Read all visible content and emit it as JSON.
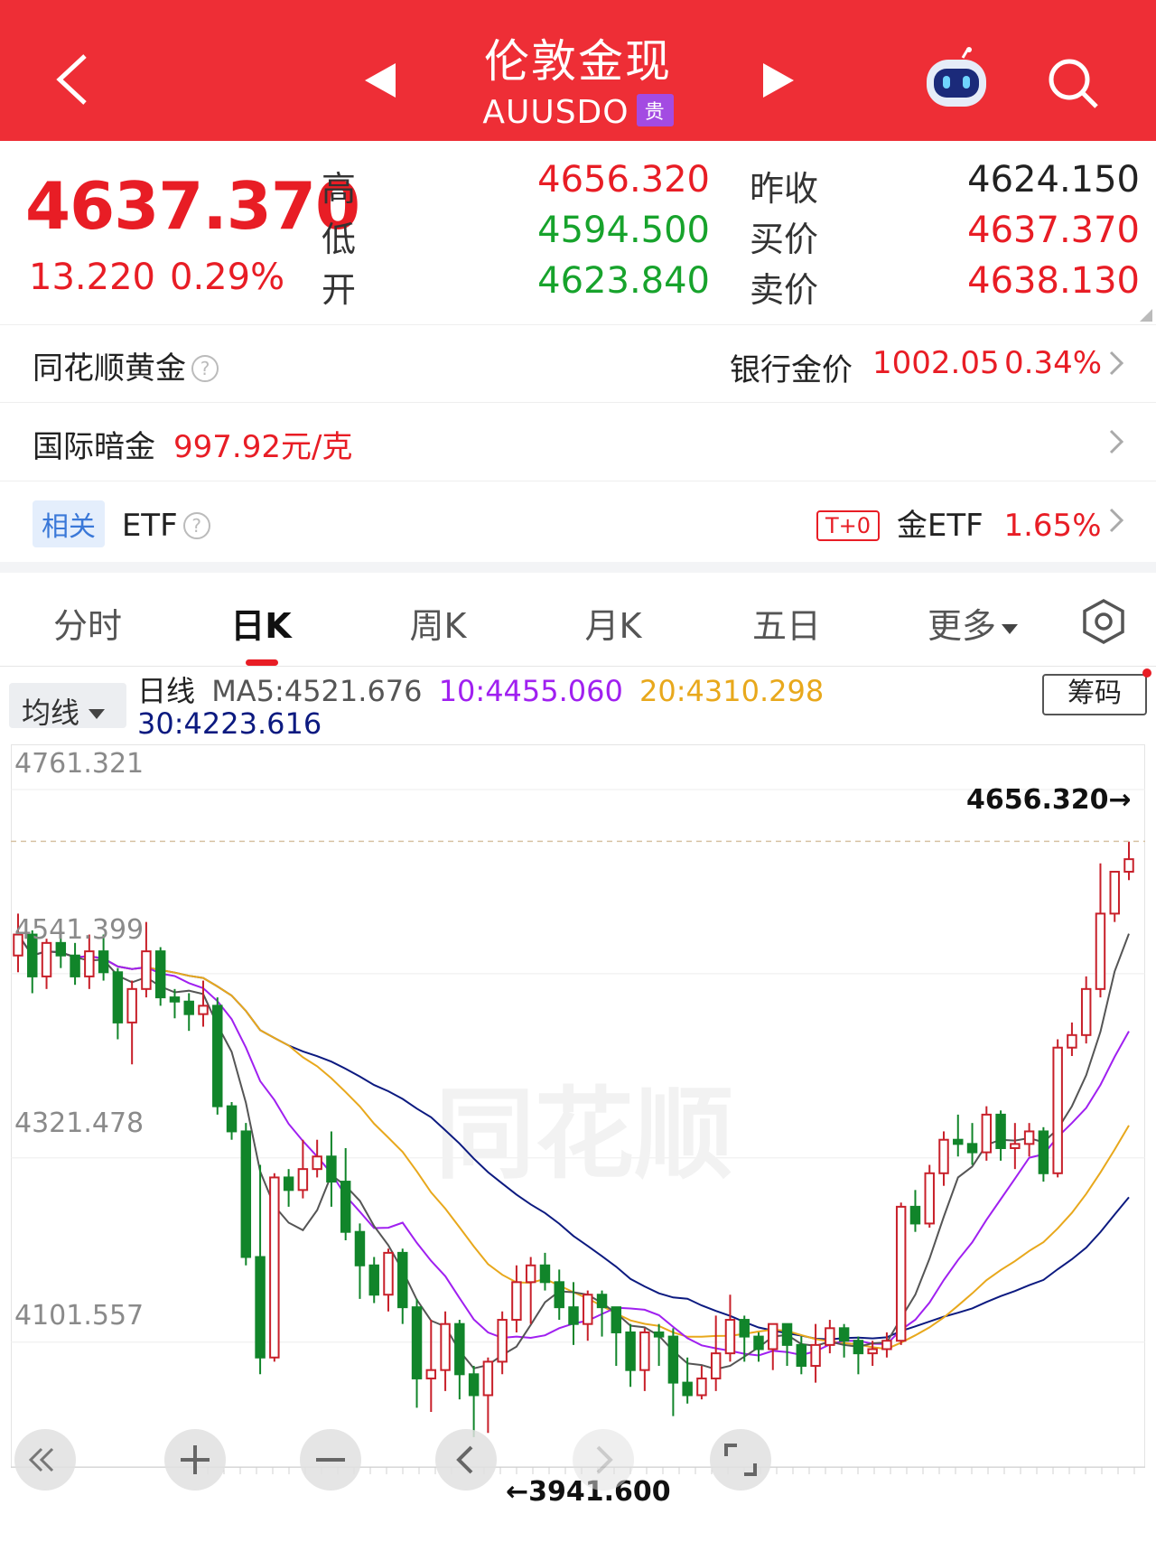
{
  "header": {
    "title": "伦敦金现",
    "code": "AUUSDO",
    "badge": "贵",
    "icons": [
      "back-icon",
      "prev-triangle-icon",
      "next-triangle-icon",
      "robot-icon",
      "search-icon"
    ]
  },
  "quote": {
    "price": "4637.370",
    "change": "13.220",
    "change_pct": "0.29%",
    "high_label": "高",
    "high": "4656.320",
    "low_label": "低",
    "low": "4594.500",
    "open_label": "开",
    "open": "4623.840",
    "prev_close_label": "昨收",
    "prev_close": "4624.150",
    "bid_label": "买价",
    "bid": "4637.370",
    "ask_label": "卖价",
    "ask": "4638.130"
  },
  "rows": {
    "ths_gold": {
      "label": "同花顺黄金",
      "bank_label": "银行金价",
      "bank_price": "1002.05",
      "bank_pct": "0.34%"
    },
    "intl_dark": {
      "label": "国际暗金",
      "value": "997.92元/克"
    },
    "etf": {
      "tag": "相关",
      "label": "ETF",
      "t0": "T+0",
      "etf_name": "金ETF",
      "etf_pct": "1.65%"
    }
  },
  "tabs": [
    "分时",
    "日K",
    "周K",
    "月K",
    "五日",
    "更多"
  ],
  "active_tab": "日K",
  "ma": {
    "select": "均线",
    "period": "日线",
    "ma5": "MA5:4521.676",
    "ma10": "10:4455.060",
    "ma20": "20:4310.298",
    "ma30": "30:4223.616",
    "chip_button": "筹码",
    "colors": {
      "ma5": "#555555",
      "ma10": "#a020f0",
      "ma20": "#e8a81c",
      "ma30": "#0c1a80"
    }
  },
  "chart_data": {
    "type": "candlestick",
    "y_tick_labels": [
      "4761.321",
      "4541.399",
      "4321.478",
      "4101.557"
    ],
    "high_label": "4656.320→",
    "low_label": "←3941.600",
    "ylim": [
      3941.6,
      4761.321
    ],
    "candles": [
      [
        4520,
        4545,
        4500,
        4570
      ],
      [
        4545,
        4495,
        4475,
        4550
      ],
      [
        4495,
        4535,
        4480,
        4540
      ],
      [
        4535,
        4520,
        4505,
        4550
      ],
      [
        4520,
        4495,
        4485,
        4535
      ],
      [
        4495,
        4525,
        4480,
        4545
      ],
      [
        4525,
        4500,
        4490,
        4545
      ],
      [
        4500,
        4440,
        4420,
        4505
      ],
      [
        4440,
        4480,
        4390,
        4490
      ],
      [
        4480,
        4525,
        4470,
        4560
      ],
      [
        4525,
        4470,
        4460,
        4530
      ],
      [
        4470,
        4465,
        4445,
        4480
      ],
      [
        4465,
        4450,
        4430,
        4475
      ],
      [
        4450,
        4460,
        4435,
        4490
      ],
      [
        4460,
        4340,
        4330,
        4470
      ],
      [
        4340,
        4310,
        4300,
        4345
      ],
      [
        4310,
        4160,
        4150,
        4320
      ],
      [
        4160,
        4040,
        4020,
        4270
      ],
      [
        4040,
        4255,
        4035,
        4260
      ],
      [
        4255,
        4240,
        4220,
        4265
      ],
      [
        4240,
        4265,
        4230,
        4300
      ],
      [
        4265,
        4280,
        4255,
        4300
      ],
      [
        4280,
        4250,
        4220,
        4310
      ],
      [
        4250,
        4190,
        4180,
        4290
      ],
      [
        4190,
        4150,
        4110,
        4200
      ],
      [
        4150,
        4115,
        4105,
        4160
      ],
      [
        4115,
        4165,
        4095,
        4170
      ],
      [
        4165,
        4100,
        4080,
        4170
      ],
      [
        4100,
        4015,
        3980,
        4110
      ],
      [
        4015,
        4025,
        3975,
        4085
      ],
      [
        4025,
        4080,
        4000,
        4095
      ],
      [
        4080,
        4020,
        3990,
        4085
      ],
      [
        4020,
        3995,
        3945,
        4030
      ],
      [
        3995,
        4035,
        3950,
        4040
      ],
      [
        4035,
        4085,
        4020,
        4095
      ],
      [
        4085,
        4130,
        4070,
        4150
      ],
      [
        4130,
        4150,
        4080,
        4160
      ],
      [
        4150,
        4130,
        4120,
        4165
      ],
      [
        4130,
        4100,
        4085,
        4145
      ],
      [
        4100,
        4080,
        4055,
        4130
      ],
      [
        4080,
        4115,
        4060,
        4120
      ],
      [
        4115,
        4100,
        4065,
        4120
      ],
      [
        4100,
        4070,
        4030,
        4100
      ],
      [
        4070,
        4025,
        4005,
        4080
      ],
      [
        4025,
        4070,
        4000,
        4075
      ],
      [
        4070,
        4065,
        4030,
        4080
      ],
      [
        4065,
        4010,
        3970,
        4075
      ],
      [
        4010,
        3995,
        3985,
        4040
      ],
      [
        3995,
        4015,
        3990,
        4030
      ],
      [
        4015,
        4045,
        4000,
        4090
      ],
      [
        4045,
        4085,
        4035,
        4115
      ],
      [
        4085,
        4065,
        4035,
        4090
      ],
      [
        4065,
        4050,
        4035,
        4070
      ],
      [
        4050,
        4080,
        4025,
        4080
      ],
      [
        4080,
        4055,
        4030,
        4080
      ],
      [
        4055,
        4030,
        4020,
        4065
      ],
      [
        4030,
        4055,
        4010,
        4080
      ],
      [
        4055,
        4075,
        4045,
        4085
      ],
      [
        4075,
        4060,
        4040,
        4080
      ],
      [
        4060,
        4045,
        4020,
        4065
      ],
      [
        4045,
        4050,
        4030,
        4060
      ],
      [
        4050,
        4060,
        4040,
        4070
      ],
      [
        4060,
        4220,
        4055,
        4225
      ],
      [
        4220,
        4200,
        4190,
        4240
      ],
      [
        4200,
        4260,
        4195,
        4270
      ],
      [
        4260,
        4300,
        4245,
        4310
      ],
      [
        4300,
        4295,
        4280,
        4330
      ],
      [
        4295,
        4285,
        4270,
        4320
      ],
      [
        4285,
        4330,
        4275,
        4340
      ],
      [
        4330,
        4290,
        4275,
        4335
      ],
      [
        4290,
        4295,
        4265,
        4320
      ],
      [
        4295,
        4310,
        4280,
        4320
      ],
      [
        4310,
        4260,
        4250,
        4315
      ],
      [
        4260,
        4410,
        4255,
        4420
      ],
      [
        4410,
        4425,
        4400,
        4440
      ],
      [
        4425,
        4480,
        4415,
        4495
      ],
      [
        4480,
        4570,
        4470,
        4630
      ],
      [
        4570,
        4620,
        4560,
        4620
      ],
      [
        4620,
        4635,
        4610,
        4656
      ]
    ]
  },
  "controls": [
    "collapse-icon",
    "zoom-in-icon",
    "zoom-out-icon",
    "scroll-left-icon",
    "scroll-right-icon",
    "fullscreen-icon"
  ]
}
